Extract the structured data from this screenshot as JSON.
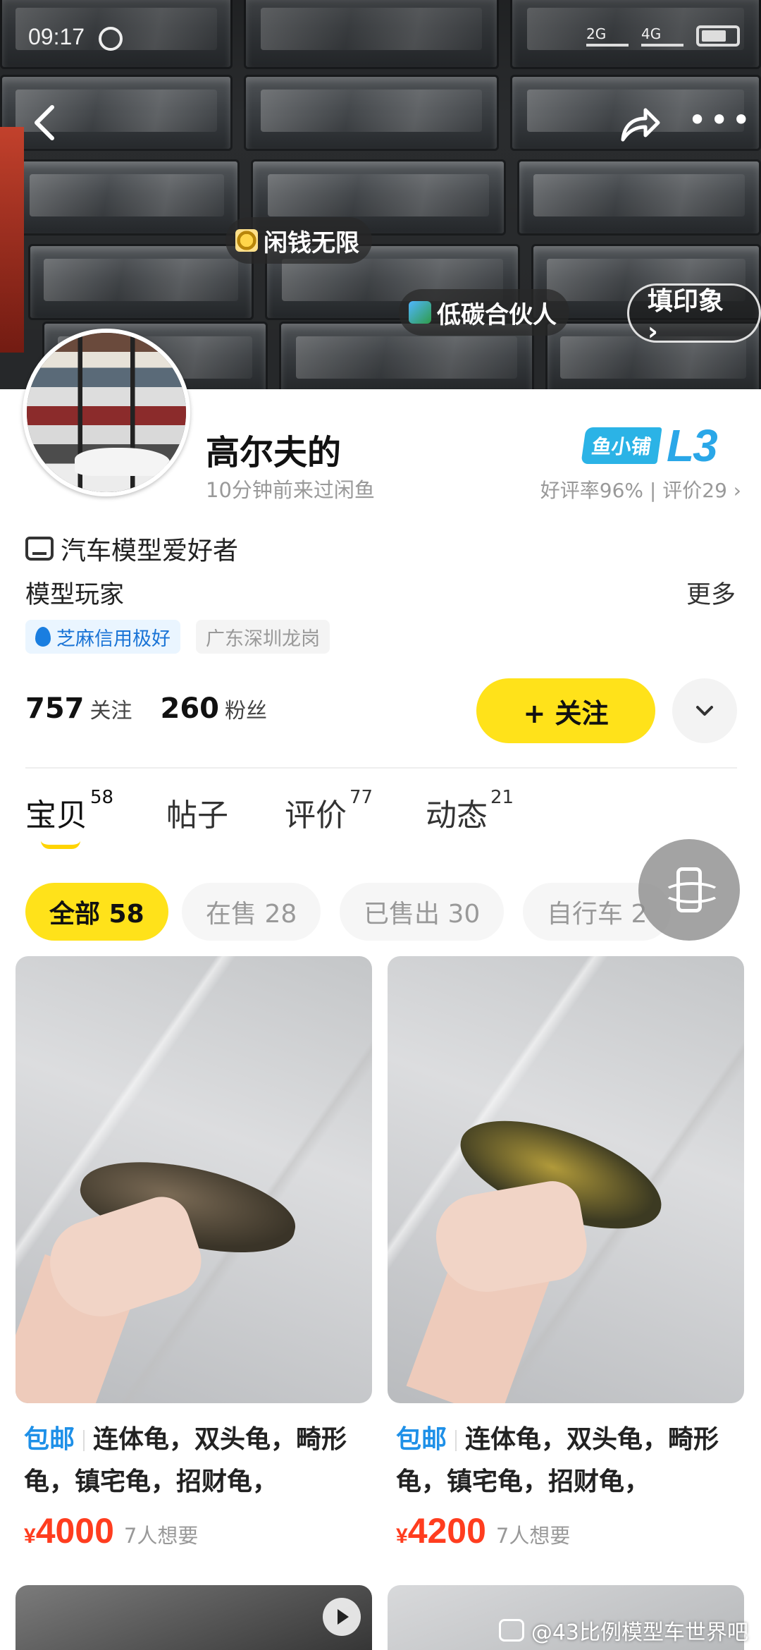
{
  "status_bar": {
    "time": "09:17",
    "signal_1": "2G",
    "signal_2": "4G"
  },
  "banner": {
    "pills": {
      "money": "闲钱无限",
      "carbon": "低碳合伙人",
      "impression": "填印象 ›"
    }
  },
  "profile": {
    "name": "高尔夫的",
    "last_seen": "10分钟前来过闲鱼",
    "shop_badge": "鱼小铺",
    "shop_level": "L3",
    "rating": "好评率96% | 评价29 ›",
    "tagline": "汽车模型爱好者",
    "bio": "模型玩家",
    "more": "更多",
    "credit_chip": "芝麻信用极好",
    "location_chip": "广东深圳龙岗",
    "following_count": "757",
    "following_label": "关注",
    "fans_count": "260",
    "fans_label": "粉丝",
    "follow_button": "+ 关注"
  },
  "tabs": [
    {
      "label": "宝贝",
      "count": "58"
    },
    {
      "label": "帖子",
      "count": ""
    },
    {
      "label": "评价",
      "count": "77"
    },
    {
      "label": "动态",
      "count": "21"
    }
  ],
  "filters": [
    {
      "label": "全部 58",
      "active": true
    },
    {
      "label": "在售 28"
    },
    {
      "label": "已售出 30"
    },
    {
      "label": "自行车 2"
    }
  ],
  "products": [
    {
      "free_shipping": "包邮",
      "title": "连体龟，双头龟，畸形龟，镇宅龟，招财龟，",
      "currency": "¥",
      "price": "4000",
      "wants": "7人想要"
    },
    {
      "free_shipping": "包邮",
      "title": "连体龟，双头龟，畸形龟，镇宅龟，招财龟，",
      "currency": "¥",
      "price": "4200",
      "wants": "7人想要"
    }
  ],
  "watermark": "@43比例模型车世界吧",
  "colors": {
    "accent_yellow": "#ffe21a",
    "price_red": "#ff3d1f",
    "link_blue": "#1e90e8",
    "shop_blue": "#2aa7e8"
  }
}
